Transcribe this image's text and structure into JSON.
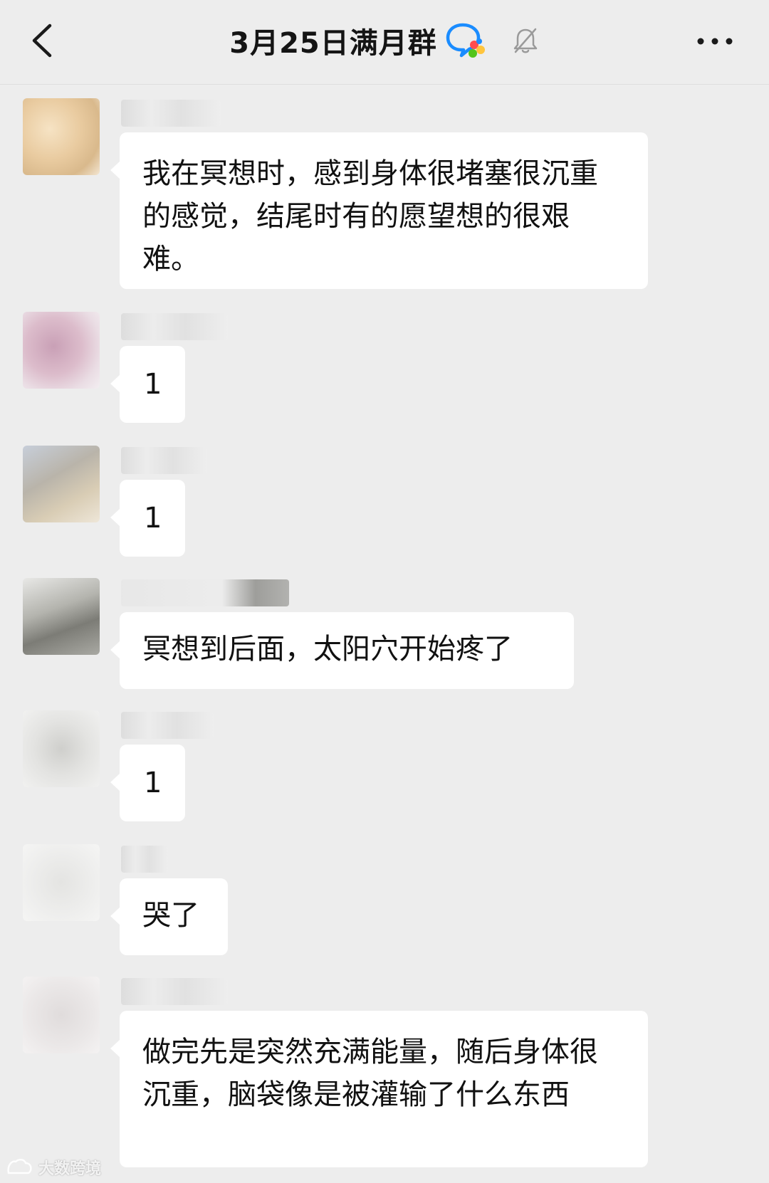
{
  "header": {
    "title": "3月25日满月群",
    "back_icon": "chevron-left-icon",
    "group_icon": "group-chat-icon",
    "mute_icon": "bell-off-icon",
    "more_icon": "more-horizontal-icon"
  },
  "messages": [
    {
      "id": "m1",
      "text": "我在冥想时，感到身体很堵塞很沉重的感觉，结尾时有的愿望想的很艰难。"
    },
    {
      "id": "m2",
      "text": "1"
    },
    {
      "id": "m3",
      "text": "1"
    },
    {
      "id": "m4",
      "text": "冥想到后面，太阳穴开始疼了"
    },
    {
      "id": "m5",
      "text": "1"
    },
    {
      "id": "m6",
      "text": "哭了"
    },
    {
      "id": "m7",
      "text": "做完先是突然充满能量，随后身体很沉重，脑袋像是被灌输了什么东西"
    }
  ],
  "colors": {
    "background": "#ededed",
    "bubble": "#ffffff",
    "text": "#111111",
    "group_icon_blue": "#1a8cff"
  },
  "watermark": {
    "text": "大数跨境"
  }
}
